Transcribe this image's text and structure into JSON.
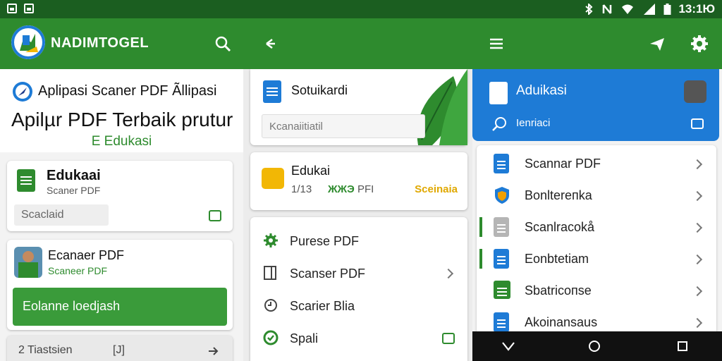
{
  "status": {
    "time": "13:1Ю"
  },
  "appbar": {
    "title": "NADIMTOGEL"
  },
  "panel1": {
    "header_line1": "Aplipasi Scaner PDF Ãllipasi",
    "header_line2": "Apilµr PDF Terbaik prutur",
    "header_line3": "E Edukasi",
    "card1": {
      "title": "Edukaai",
      "subtitle": "Scaner PDF",
      "button": "Scaclaid"
    },
    "card2": {
      "title": "Ecanaer PDF",
      "subtitle": "Scaneer PDF",
      "cta": "Eolanne loedjash"
    },
    "footer": {
      "left": "2 Tiastsien",
      "mid": "[J]"
    }
  },
  "panel2": {
    "card1": {
      "title": "Sotuikardi",
      "input": "Kcanaiitiatil"
    },
    "card2": {
      "title": "Edukai",
      "meta1": "1/13",
      "meta2": "ЖЖЭ",
      "meta3": "PFI",
      "status": "Sceinaia"
    },
    "menu": [
      {
        "label": "Purese PDF",
        "icon": "gear-icon"
      },
      {
        "label": "Scanser PDF",
        "icon": "square-icon"
      },
      {
        "label": "Scarier Blia",
        "icon": "clock-icon"
      },
      {
        "label": "Spali",
        "icon": "check-circle-icon"
      }
    ]
  },
  "panel3": {
    "header": {
      "title": "Aduikasi",
      "search": "Ienriaci"
    },
    "list": [
      {
        "label": "Scannar PDF",
        "icon": "blue-doc-icon"
      },
      {
        "label": "Bonlterепka",
        "icon": "shield-icon"
      },
      {
        "label": "Scanlrаcokå",
        "icon": "grey-doc-icon"
      },
      {
        "label": "Eonbtetiam",
        "icon": "blue-doc-icon"
      },
      {
        "label": "Sbatricoпse",
        "icon": "green-doc-icon"
      },
      {
        "label": "Akoinansaus",
        "icon": "blue-doc-icon"
      }
    ]
  },
  "colors": {
    "primary": "#2e8b2e",
    "dark": "#1b5e20",
    "accent_blue": "#1e7bd6",
    "accent_yellow": "#f2b705"
  }
}
